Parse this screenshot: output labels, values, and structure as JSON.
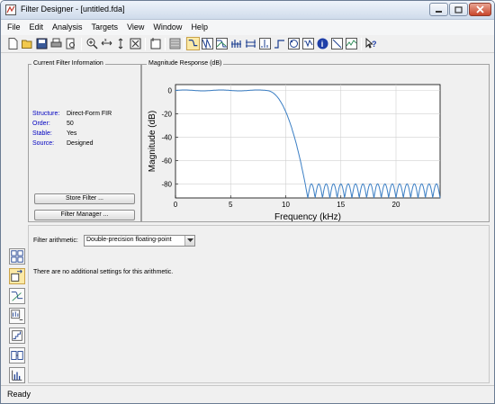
{
  "window": {
    "title": "Filter Designer - [untitled.fda]"
  },
  "menu": [
    "File",
    "Edit",
    "Analysis",
    "Targets",
    "View",
    "Window",
    "Help"
  ],
  "toolbar": {
    "icons": [
      "new-icon",
      "open-icon",
      "save-icon",
      "print-icon",
      "print-preview-icon",
      "zoom-in-icon",
      "zoom-x-icon",
      "zoom-y-icon",
      "full-view-icon",
      "new-figure-icon",
      "filter-specs-icon",
      "magnitude-response-icon",
      "phase-response-icon",
      "mag-phase-icon",
      "group-delay-icon",
      "phase-delay-icon",
      "impulse-response-icon",
      "step-response-icon",
      "pole-zero-icon",
      "coefficients-icon",
      "info-icon",
      "cost-icon",
      "noise-icon",
      "help-pointer-icon"
    ]
  },
  "current_filter": {
    "title": "Current Filter Information",
    "rows": [
      {
        "key": "Structure:",
        "value": "Direct-Form FIR"
      },
      {
        "key": "Order:",
        "value": "50"
      },
      {
        "key": "Stable:",
        "value": "Yes"
      },
      {
        "key": "Source:",
        "value": "Designed"
      }
    ],
    "store_button": "Store Filter ...",
    "manager_button": "Filter Manager ..."
  },
  "magnitude_panel": {
    "title": "Magnitude Response (dB)"
  },
  "chart_data": {
    "type": "line",
    "xlabel": "Frequency (kHz)",
    "ylabel": "Magnitude (dB)",
    "xlim": [
      0,
      24
    ],
    "ylim": [
      -92,
      5
    ],
    "xticks": [
      0,
      5,
      10,
      15,
      20
    ],
    "yticks": [
      0,
      -20,
      -40,
      -60,
      -80
    ],
    "grid": true,
    "series": [
      {
        "color": "#3a7ec4",
        "passband_edge_khz": 9.6,
        "stopband_edge_khz": 12.0,
        "stopband_floor_db": -92,
        "stopband_peak_db": -80,
        "stopband_lobes": 18
      }
    ]
  },
  "arithmetic": {
    "label": "Filter arithmetic:",
    "value": "Double-precision floating-point",
    "message": "There are no additional settings for this arithmetic."
  },
  "sidebar": {
    "icons": [
      "design-filter-icon",
      "import-filter-icon",
      "transform-filter-icon",
      "multirate-icon",
      "quantize-icon",
      "realize-model-icon",
      "pole-zero-editor-icon"
    ]
  },
  "status": {
    "text": "Ready"
  },
  "colors": {
    "accent": "#3a7ec4",
    "info_key": "#0000c0",
    "pressed": "#fbe9a6"
  }
}
